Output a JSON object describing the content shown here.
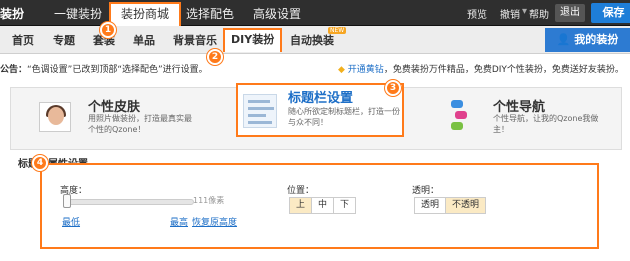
{
  "topbar": {
    "brand": "装扮",
    "tabs": [
      "一键装扮",
      "装扮商城",
      "选择配色",
      "高级设置"
    ],
    "active_tab": "装扮商城",
    "preview": "预览",
    "undo": "撤销",
    "help": "帮助",
    "exit": "退出",
    "save": "保存"
  },
  "subnav": {
    "tabs": [
      "首页",
      "专题",
      "套装",
      "单品",
      "背景音乐",
      "DIY装扮",
      "自动换装"
    ],
    "active_tab": "DIY装扮",
    "new_badge": "NEW",
    "my_skin": "我的装扮"
  },
  "notice": {
    "label": "公告：",
    "text": "“色调设置”已改到顶部“选择配色”进行设置。"
  },
  "promo": {
    "link": "开通黄钻",
    "text": "，免费装扮万件精品，免费DIY个性装扮，免费送好友装扮。"
  },
  "cards": [
    {
      "title": "个性皮肤",
      "desc": "用照片做装扮，打造最真实最个性的Qzone！",
      "icon": "photo-skin-icon"
    },
    {
      "title": "标题栏设置",
      "desc": "随心所欲定制标题栏，打造一份与众不同！",
      "icon": "title-bar-icon"
    },
    {
      "title": "个性导航",
      "desc": "个性导航，让我的Qzone我做主！",
      "icon": "nav-icon"
    }
  ],
  "settings": {
    "section_title": "标题栏属性设置",
    "height_label": "高度：",
    "height_value": "111像素",
    "min_label": "最低",
    "max_label": "最高",
    "restore_label": "恢复原高度",
    "position_label": "位置：",
    "position_options": [
      "上",
      "中",
      "下"
    ],
    "position_selected": "上",
    "transparency_label": "透明：",
    "transparency_options": [
      "透明",
      "不透明"
    ],
    "transparency_selected": "不透明"
  },
  "markers": [
    "1",
    "2",
    "3",
    "4"
  ],
  "colors": {
    "accent": "#ff7a1a",
    "link": "#1e6fc7",
    "primary_button": "#1e7ed8"
  }
}
